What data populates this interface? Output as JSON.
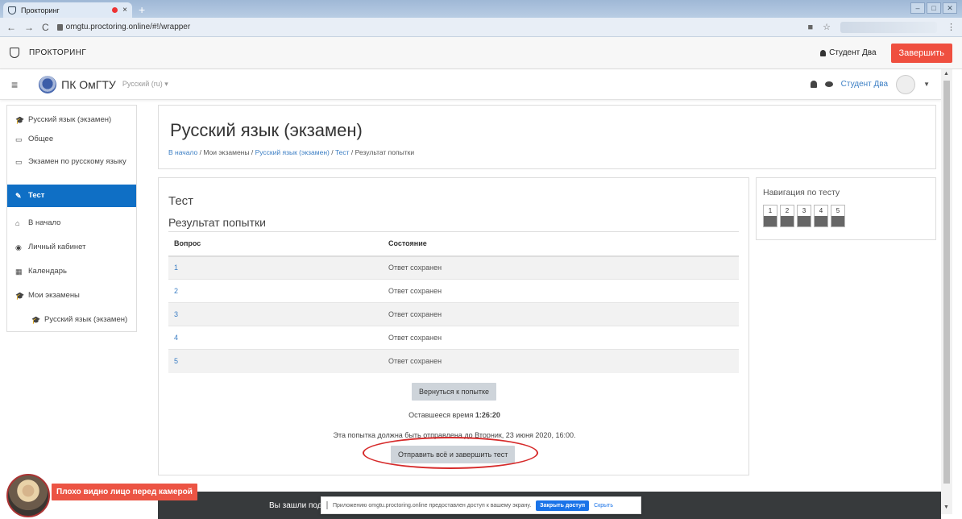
{
  "browser": {
    "tab_title": "Прокторинг",
    "tab_close": "×",
    "new_tab": "+",
    "url": "omgtu.proctoring.online/#!/wrapper"
  },
  "proctor": {
    "title": "ПРОКТОРИНГ",
    "user": "Студент Два",
    "finish": "Завершить"
  },
  "header": {
    "site_name": "ПК ОмГТУ",
    "lang": "Русский (ru) ▾",
    "user": "Студент Два"
  },
  "sidebar": {
    "items": [
      {
        "icon": "🎓",
        "label": "Русский язык (экзамен)"
      },
      {
        "icon": "▭",
        "label": "Общее"
      },
      {
        "icon": "▭",
        "label": "Экзамен по русскому языку"
      },
      {
        "icon": "✎",
        "label": "Тест"
      },
      {
        "icon": "⌂",
        "label": "В начало"
      },
      {
        "icon": "◉",
        "label": "Личный кабинет"
      },
      {
        "icon": "▦",
        "label": "Календарь"
      },
      {
        "icon": "🎓",
        "label": "Мои экзамены"
      },
      {
        "icon": "🎓",
        "label": "Русский язык (экзамен)"
      }
    ]
  },
  "page": {
    "title": "Русский язык (экзамен)",
    "breadcrumb": [
      "В начало",
      "Мои экзамены",
      "Русский язык (экзамен)",
      "Тест",
      "Результат попытки"
    ]
  },
  "quiz": {
    "title": "Тест",
    "subtitle": "Результат попытки",
    "columns": [
      "Вопрос",
      "Состояние"
    ],
    "rows": [
      {
        "q": "1",
        "state": "Ответ сохранен"
      },
      {
        "q": "2",
        "state": "Ответ сохранен"
      },
      {
        "q": "3",
        "state": "Ответ сохранен"
      },
      {
        "q": "4",
        "state": "Ответ сохранен"
      },
      {
        "q": "5",
        "state": "Ответ сохранен"
      }
    ],
    "return_button": "Вернуться к попытке",
    "time_label": "Оставшееся время",
    "time_value": "1:26:20",
    "deadline_text": "Эта попытка должна быть отправлена до Вторник, 23 июня 2020, 16:00.",
    "submit_button": "Отправить всё и завершить тест"
  },
  "nav": {
    "title": "Навигация по тесту",
    "buttons": [
      "1",
      "2",
      "3",
      "4",
      "5"
    ]
  },
  "footer": {
    "text": "Вы зашли под"
  },
  "notice": {
    "text": "Приложению omgtu.proctoring.online предоставлен доступ к вашему экрану.",
    "share_button": "Закрыть доступ",
    "hide_link": "Скрыть"
  },
  "warning": {
    "text": "Плохо видно лицо перед камерой"
  },
  "colors": {
    "accent": "#0f6fc5",
    "link": "#3b7ec4",
    "danger": "#ef4f3f"
  }
}
